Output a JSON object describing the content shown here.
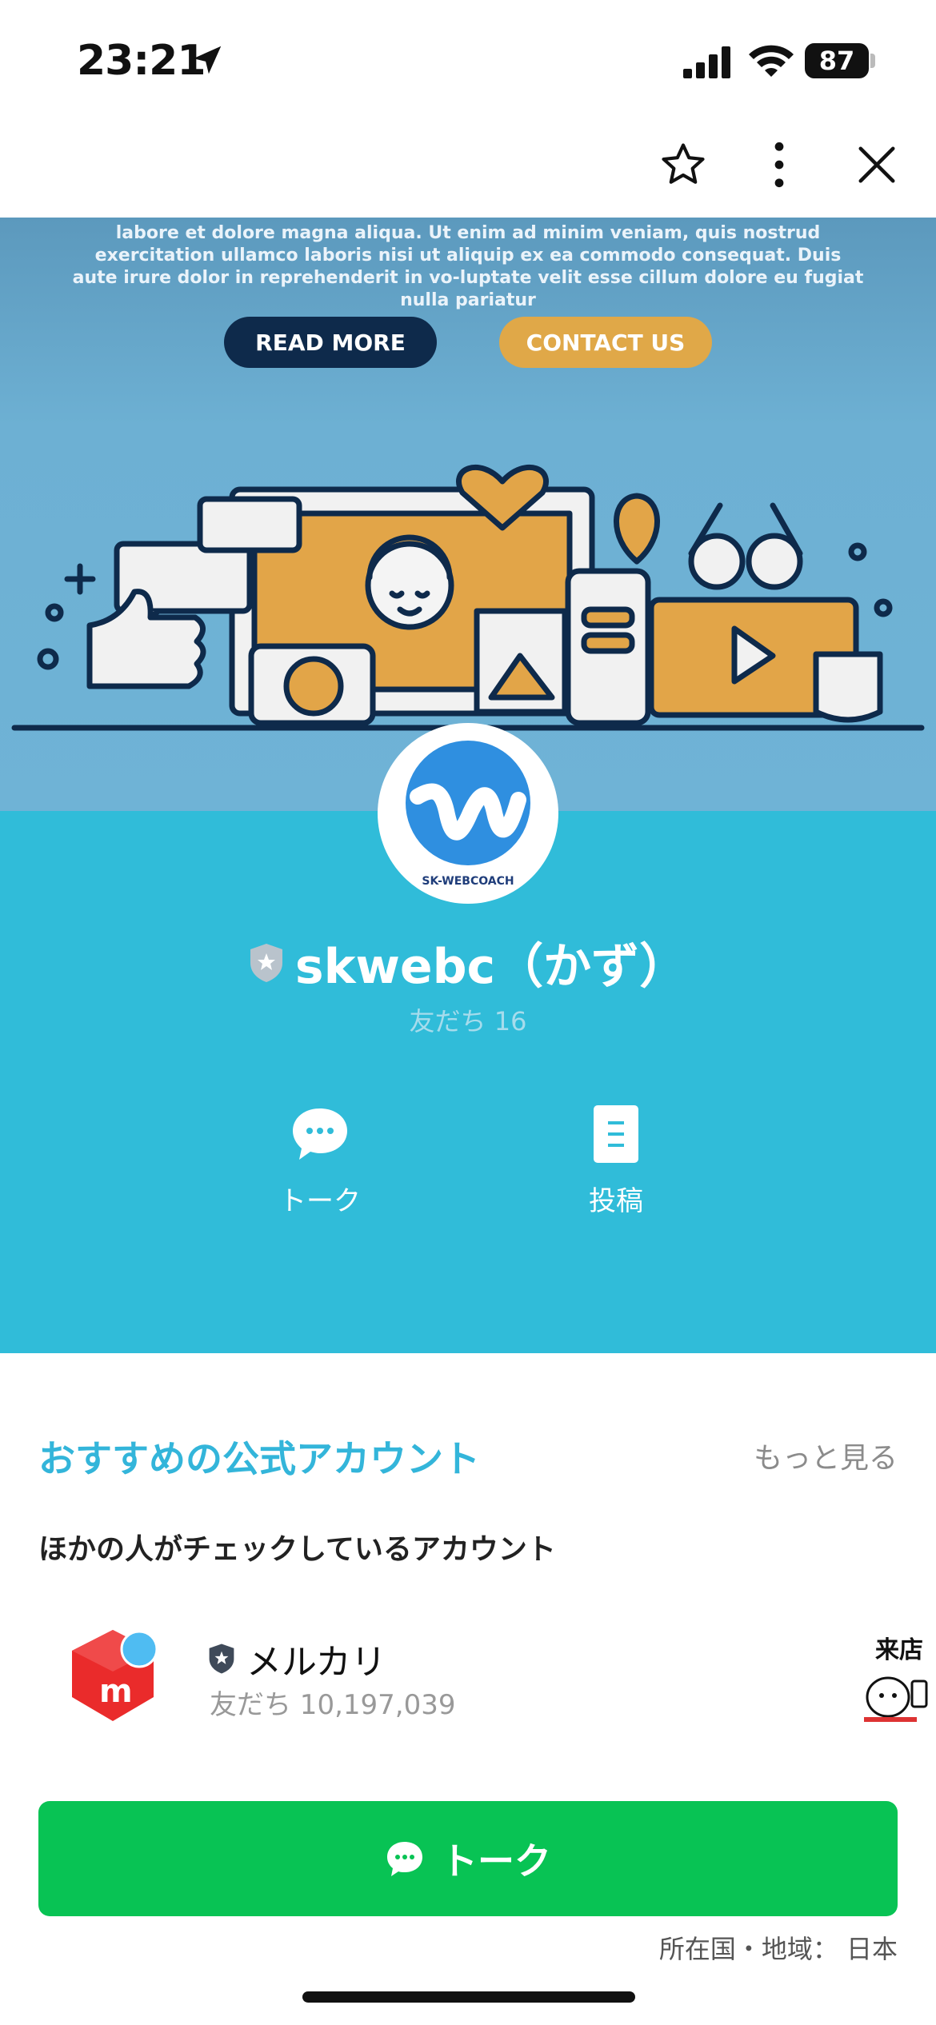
{
  "status_bar": {
    "time": "23:21",
    "battery": "87"
  },
  "cover": {
    "body_text": "labore et dolore magna aliqua. Ut enim ad minim veniam, quis nostrud exercitation ullamco laboris nisi ut aliquip ex ea commodo consequat. Duis aute irure dolor in reprehenderit in vo-luptate velit esse cillum dolore eu fugiat nulla pariatur",
    "read_more": "READ MORE",
    "contact_us": "CONTACT US"
  },
  "profile": {
    "avatar_caption": "SK-WEBCOACH",
    "name": "skwebc（かず）",
    "friends": "友だち 16",
    "actions": [
      {
        "label": "トーク",
        "icon": "chat-bubble-icon"
      },
      {
        "label": "投稿",
        "icon": "post-document-icon"
      }
    ]
  },
  "recommended": {
    "title": "おすすめの公式アカウント",
    "more": "もっと見る",
    "subtitle": "ほかの人がチェックしているアカウント",
    "accounts": [
      {
        "name": "メルカリ",
        "friends": "友だち 10,197,039"
      }
    ],
    "next_account_partial_text": "来店"
  },
  "footer": {
    "talk_button": "トーク",
    "region": "所在国・地域：  日本"
  },
  "colors": {
    "profile_bg": "#30bcd9",
    "accent_blue": "#33b5da",
    "line_green": "#08c354"
  }
}
